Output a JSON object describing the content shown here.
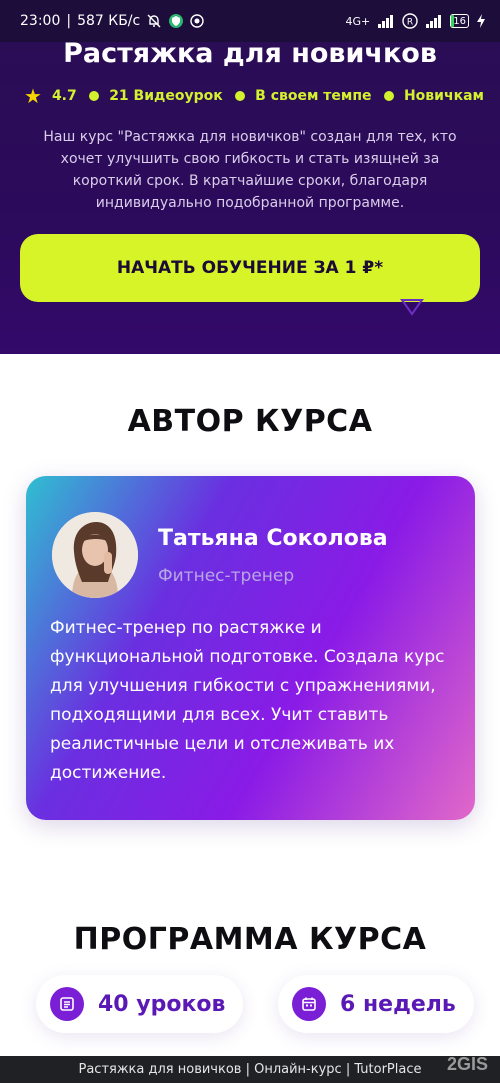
{
  "status": {
    "time": "23:00",
    "speed": "587 КБ/с",
    "network": "4G+",
    "battery": "16"
  },
  "hero": {
    "title": "Растяжка для новичков",
    "rating": "4.7",
    "lessons": "21 Видеоурок",
    "pace": "В своем темпе",
    "level": "Новичкам",
    "description": "Наш курс \"Растяжка для новичков\" создан для тех, кто хочет улучшить свою гибкость и стать изящней за короткий срок. В кратчайшие сроки, благодаря индивидуально подобранной программе.",
    "cta": "НАЧАТЬ ОБУЧЕНИЕ ЗА 1 ₽*"
  },
  "author": {
    "section_title": "АВТОР КУРСА",
    "name": "Татьяна Соколова",
    "role": "Фитнес-тренер",
    "bio": "Фитнес-тренер по растяжке и функциональной подготовке. Создала курс для улучшения гибкости с упражнениями, подходящими для всех. Учит ставить реалистичные цели и отслеживать их достижение."
  },
  "program": {
    "section_title": "ПРОГРАММА КУРСА",
    "lessons": "40 уроков",
    "weeks": "6 недель"
  },
  "footer": {
    "page_title": "Растяжка для новичков | Онлайн-курс | TutorPlace",
    "badge": "2GIS"
  },
  "colors": {
    "hero_bg": "#2c0a5c",
    "accent_lime": "#d6f427",
    "purple": "#7a1fd6"
  }
}
